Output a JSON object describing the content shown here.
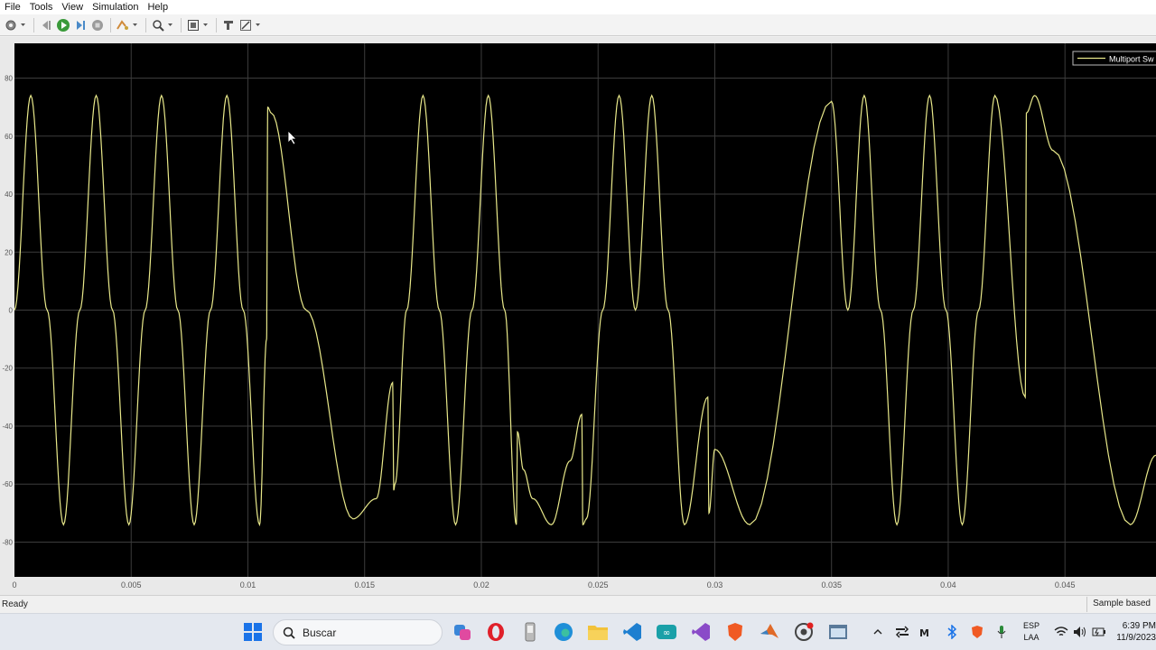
{
  "menu": [
    "File",
    "Tools",
    "View",
    "Simulation",
    "Help"
  ],
  "toolbar": {
    "icons": [
      "settings-icon",
      "step-back-icon",
      "run-icon",
      "step-forward-icon",
      "stop-icon",
      "highlight-icon",
      "zoom-icon",
      "fit-view-icon",
      "cursor-icon",
      "style-icon"
    ]
  },
  "colors": {
    "plot_bg": "#000000",
    "signal": "#e8e88a",
    "grid": "#3c3c3c",
    "axis_text": "#cccccc"
  },
  "status": {
    "left": "Ready",
    "right": "Sample based"
  },
  "taskbar": {
    "search": "Buscar",
    "lang_line1": "ESP",
    "lang_line2": "LAA",
    "time": "6:39 PM",
    "date": "11/9/2023"
  },
  "chart_data": {
    "type": "line",
    "title": "",
    "xlabel": "",
    "ylabel": "",
    "xlim": [
      0,
      0.0489
    ],
    "ylim": [
      -92,
      92
    ],
    "x_ticks": [
      "0",
      "0.005",
      "0.01",
      "0.015",
      "0.02",
      "0.025",
      "0.03",
      "0.035",
      "0.04",
      "0.045"
    ],
    "x_tick_values": [
      0,
      0.005,
      0.01,
      0.015,
      0.02,
      0.025,
      0.03,
      0.035,
      0.04,
      0.045
    ],
    "y_ticks": [
      "80",
      "60",
      "40",
      "20",
      "0",
      "-20",
      "-40",
      "-60",
      "-80"
    ],
    "y_tick_values": [
      80,
      60,
      40,
      20,
      0,
      -20,
      -40,
      -60,
      -80
    ],
    "grid": true,
    "legend_position": "top-right",
    "series": [
      {
        "name": "Multiport Sw",
        "x": [
          0,
          0.0007,
          0.0014,
          0.0021,
          0.0028,
          0.0035,
          0.0042,
          0.0049,
          0.0056,
          0.0063,
          0.007,
          0.0077,
          0.0084,
          0.0091,
          0.0098,
          0.0105,
          0.0108,
          0.01085,
          0.011,
          0.0125,
          0.0145,
          0.0155,
          0.0162,
          0.01625,
          0.0163,
          0.0168,
          0.0175,
          0.0182,
          0.0189,
          0.0196,
          0.0203,
          0.021,
          0.0215,
          0.02155,
          0.0218,
          0.0222,
          0.023,
          0.0238,
          0.0243,
          0.02435,
          0.0245,
          0.0252,
          0.0259,
          0.0266,
          0.0273,
          0.028,
          0.0287,
          0.0297,
          0.02975,
          0.03,
          0.0315,
          0.035,
          0.0357,
          0.0364,
          0.0371,
          0.0378,
          0.0385,
          0.0392,
          0.0399,
          0.0406,
          0.0413,
          0.042,
          0.0433,
          0.04335,
          0.0437,
          0.0445,
          0.0478,
          0.0489
        ],
        "values": [
          0,
          74,
          0,
          -74,
          0,
          74,
          0,
          -74,
          0,
          74,
          0,
          -74,
          0,
          74,
          0,
          -74,
          -10,
          70,
          68,
          0,
          -72,
          -65,
          -25,
          -62,
          -60,
          0,
          74,
          0,
          -74,
          0,
          74,
          0,
          -74,
          -42,
          -55,
          -65,
          -74,
          -52,
          -36,
          -74,
          -72,
          0,
          74,
          0,
          74,
          0,
          -74,
          -30,
          -70,
          -48,
          -74,
          72,
          0,
          74,
          0,
          -74,
          0,
          74,
          0,
          -74,
          0,
          74,
          -30,
          68,
          74,
          55,
          -74,
          -50
        ]
      }
    ]
  }
}
